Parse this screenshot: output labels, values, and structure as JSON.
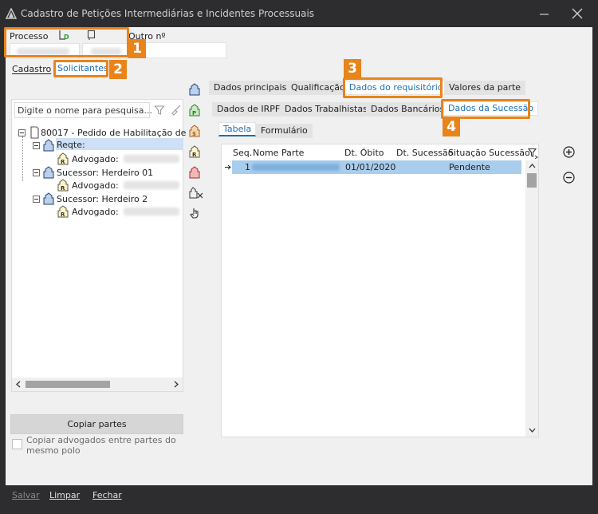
{
  "window": {
    "title": "Cadastro de Petições Intermediárias e Incidentes Processuais"
  },
  "header": {
    "processo_label": "Processo",
    "outro_label": "Outro nº",
    "badge_d": "D",
    "annot_1": "1",
    "annot_2": "2",
    "annot_3": "3",
    "annot_4": "4"
  },
  "top_tabs": [
    {
      "label": "Cadastro"
    },
    {
      "label": "Solicitantes"
    }
  ],
  "left": {
    "search_placeholder": "Digite o nome para pesquisa...",
    "tree": [
      {
        "label": "80017 - Pedido de Habilitação de"
      },
      {
        "label": "Reqte:"
      },
      {
        "label": "Advogado:"
      },
      {
        "label": "Sucessor: Herdeiro 01"
      },
      {
        "label": "Advogado:"
      },
      {
        "label": "Sucessor: Herdeiro 2"
      },
      {
        "label": "Advogado:"
      }
    ],
    "copy_button": "Copiar partes",
    "checkbox_label": "Copiar advogados entre partes do mesmo polo"
  },
  "main_tabs": [
    {
      "label": "Dados principais"
    },
    {
      "label": "Qualificação"
    },
    {
      "label": "Dados do requisitório"
    },
    {
      "label": "Valores da parte"
    }
  ],
  "sub_tabs": [
    {
      "label": "Dados de IRPF"
    },
    {
      "label": "Dados Trabalhistas"
    },
    {
      "label": "Dados Bancários"
    },
    {
      "label": "Dados da Sucessão"
    }
  ],
  "view_tabs": [
    {
      "label": "Tabela"
    },
    {
      "label": "Formulário"
    }
  ],
  "table": {
    "columns": [
      "Seq.",
      "Nome Parte",
      "Dt. Óbito",
      "Dt. Sucessão",
      "Situação Sucessão"
    ],
    "rows": [
      {
        "seq": "1",
        "nome": "",
        "obito": "01/01/2020",
        "sucessao": "",
        "situacao": "Pendente"
      }
    ]
  },
  "footer": {
    "salvar": "Salvar",
    "limpar": "Limpar",
    "fechar": "Fechar"
  },
  "colors": {
    "accent": "#e8841a",
    "selection": "#cde0f5",
    "tab_active_text": "#1f6fb5"
  }
}
